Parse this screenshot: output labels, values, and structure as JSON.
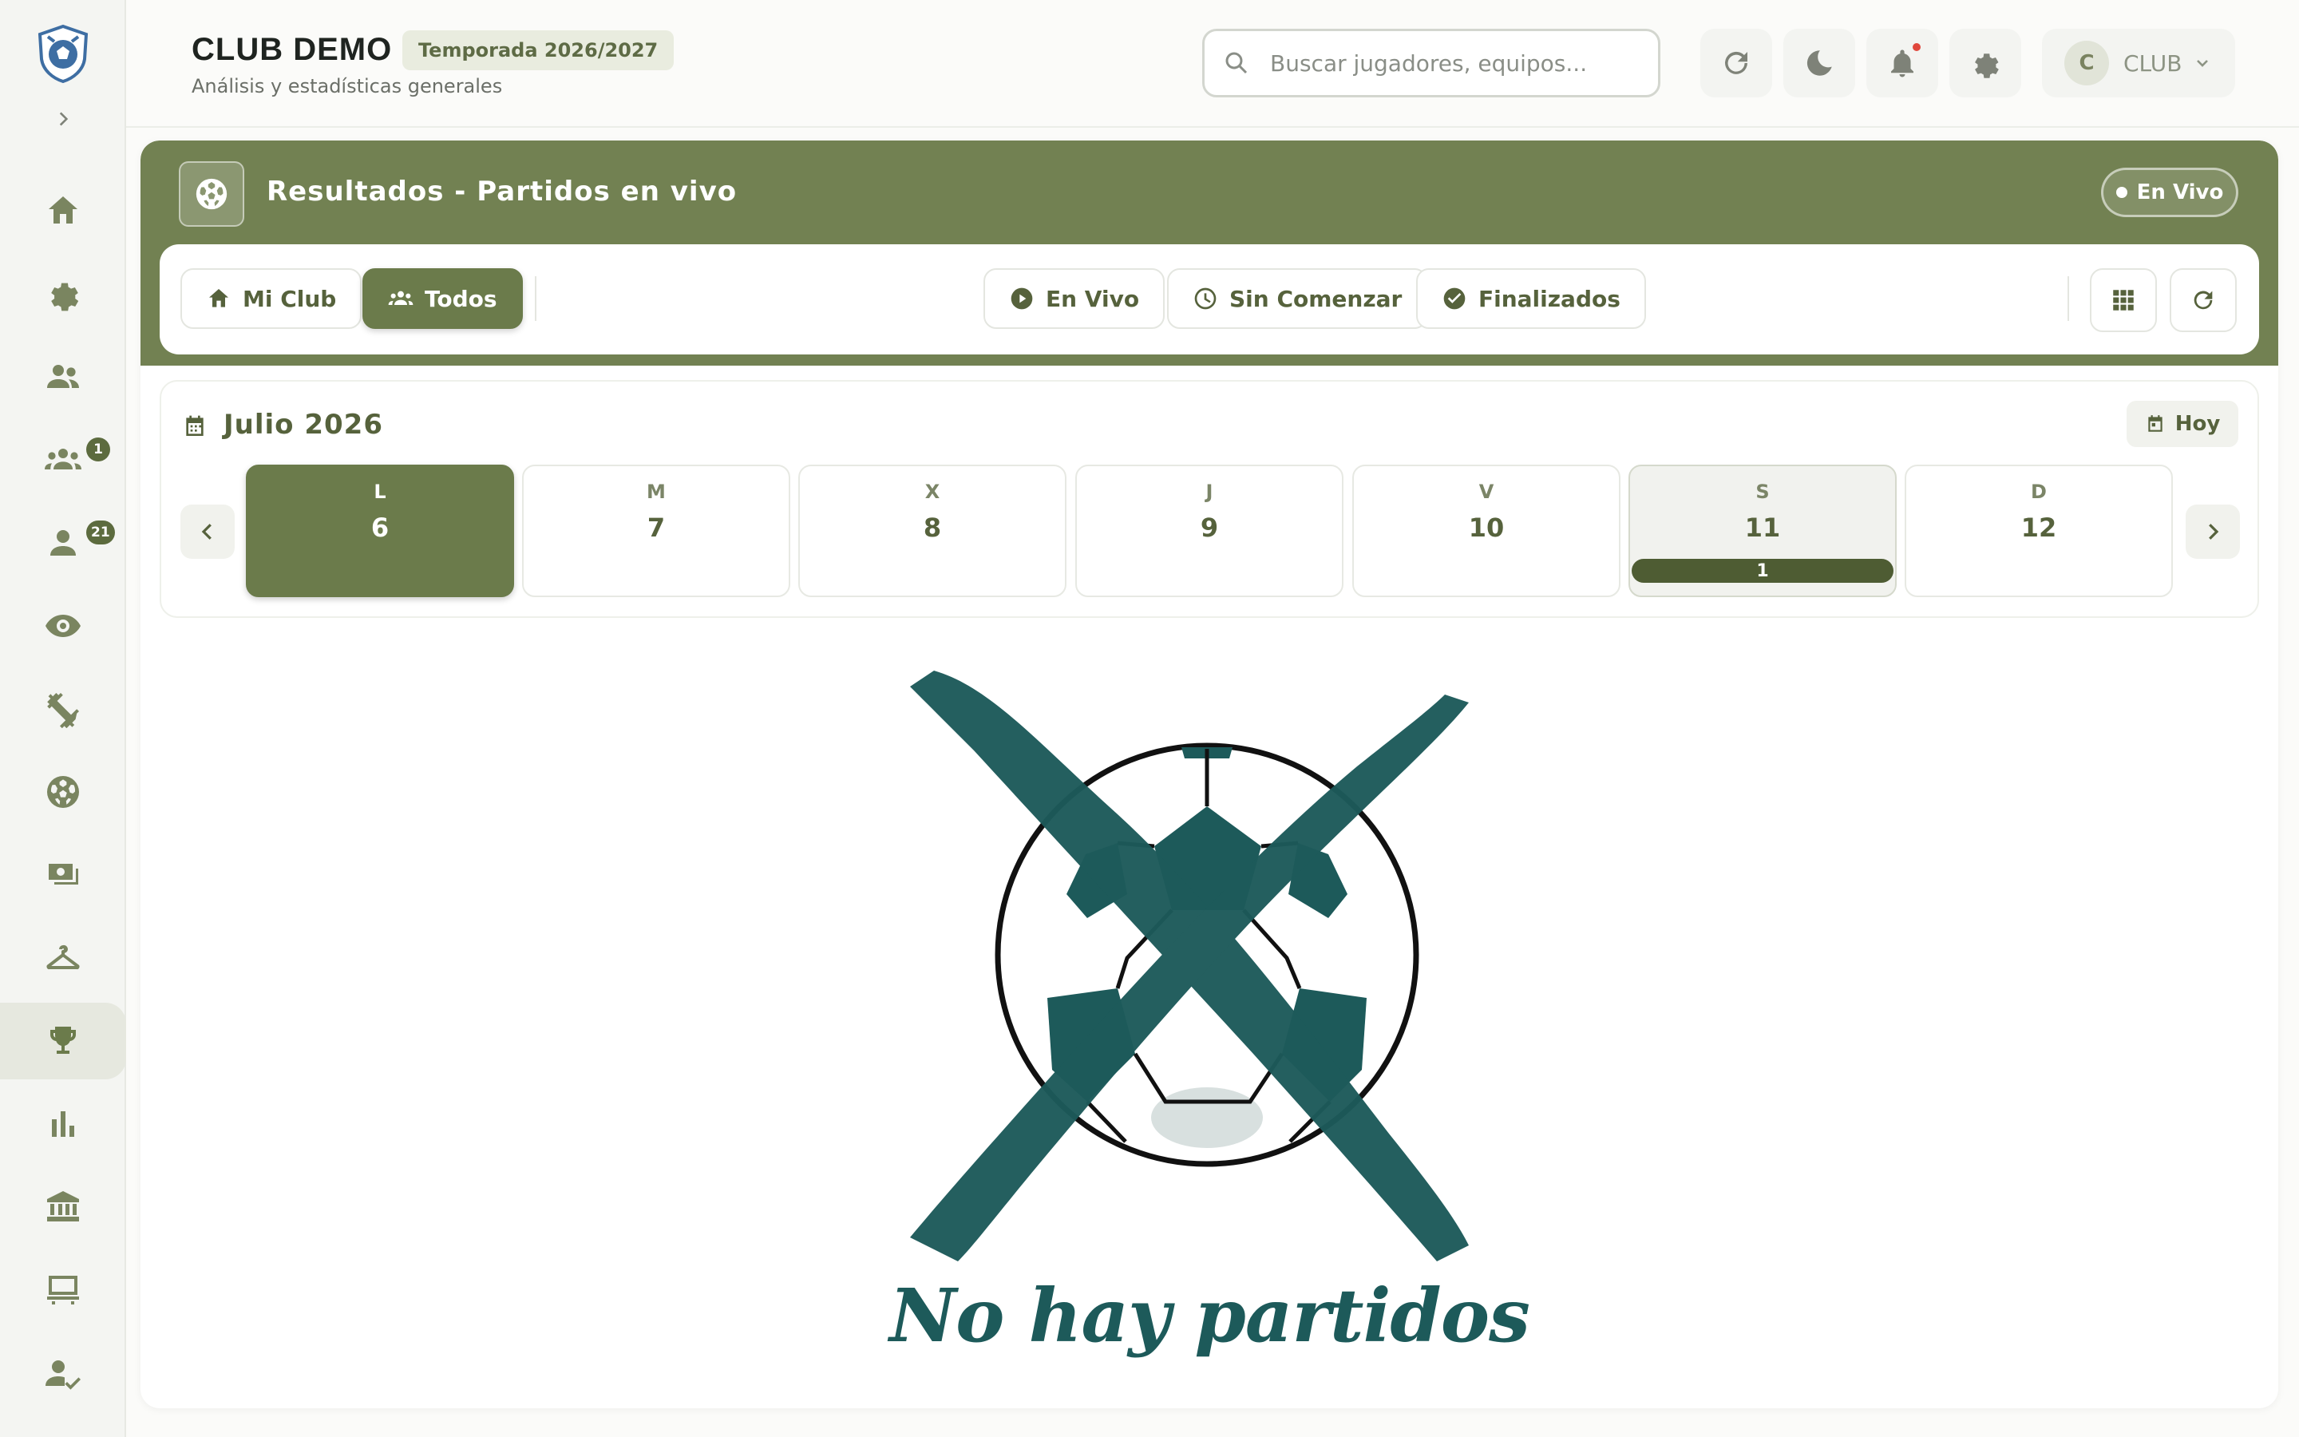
{
  "header": {
    "club_name": "CLUB DEMO",
    "season": "Temporada 2026/2027",
    "subtitle": "Análisis y estadísticas generales",
    "search_placeholder": "Buscar jugadores, equipos...",
    "user_initial": "C",
    "user_name": "CLUB"
  },
  "sidebar": {
    "items": [
      {
        "icon": "home-icon"
      },
      {
        "icon": "gear-icon"
      },
      {
        "icon": "group-icon"
      },
      {
        "icon": "teams-icon",
        "badge": "1"
      },
      {
        "icon": "person-icon",
        "badge": "21"
      },
      {
        "icon": "eye-icon"
      },
      {
        "icon": "fitness-icon"
      },
      {
        "icon": "soccer-ball-icon"
      },
      {
        "icon": "payments-icon"
      },
      {
        "icon": "hanger-icon"
      },
      {
        "icon": "trophy-icon",
        "active": true
      },
      {
        "icon": "bar-chart-icon"
      },
      {
        "icon": "institution-icon"
      },
      {
        "icon": "board-icon"
      },
      {
        "icon": "user-check-icon"
      }
    ]
  },
  "results": {
    "title": "Resultados - Partidos en vivo",
    "live_badge": "En Vivo",
    "filters": {
      "mi_club": "Mi Club",
      "todos": "Todos",
      "en_vivo": "En Vivo",
      "sin_comenzar": "Sin Comenzar",
      "finalizados": "Finalizados"
    }
  },
  "calendar": {
    "month": "Julio 2026",
    "today_label": "Hoy",
    "days": [
      {
        "letter": "L",
        "number": "6",
        "selected": true
      },
      {
        "letter": "M",
        "number": "7"
      },
      {
        "letter": "X",
        "number": "8"
      },
      {
        "letter": "J",
        "number": "9"
      },
      {
        "letter": "V",
        "number": "10"
      },
      {
        "letter": "S",
        "number": "11",
        "matches": "1"
      },
      {
        "letter": "D",
        "number": "12"
      }
    ]
  },
  "empty_state": {
    "message": "No hay partidos"
  },
  "colors": {
    "brand": "#728152",
    "brand_dark": "#56623c",
    "empty_teal": "#1d5a5a"
  }
}
